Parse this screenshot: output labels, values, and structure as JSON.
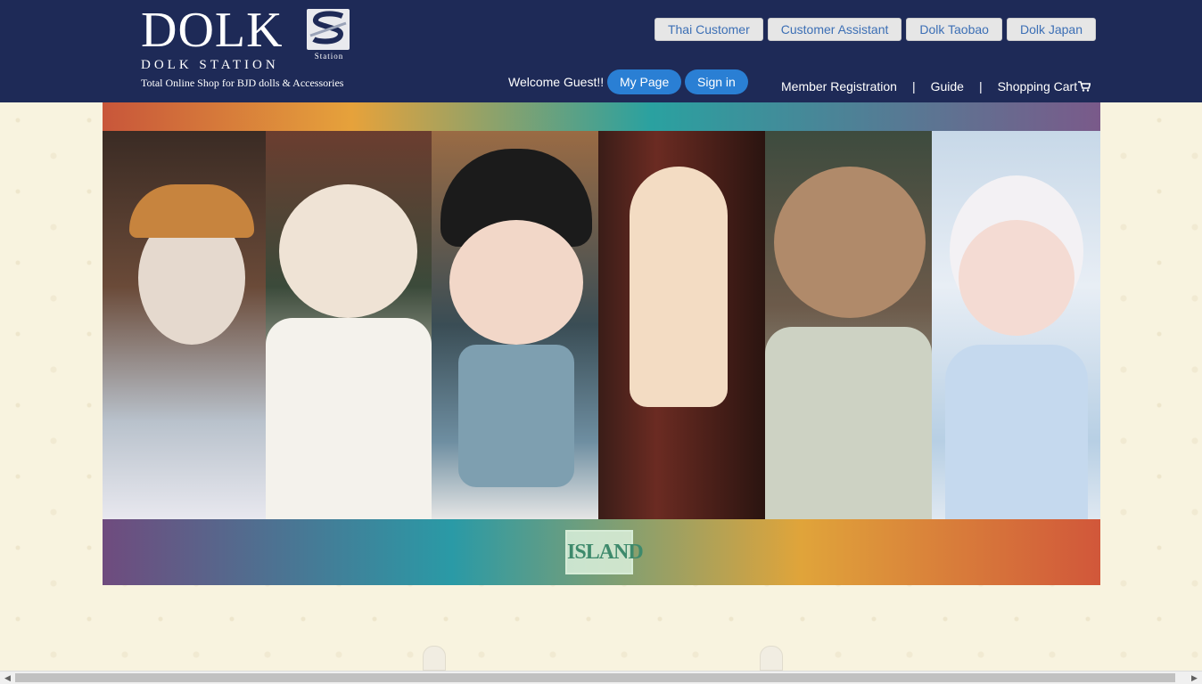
{
  "header": {
    "logo": {
      "wordmark": "DOLK",
      "mark_caption": "Station",
      "subtitle": "DOLK STATION",
      "tagline": "Total Online Shop for BJD dolls & Accessories"
    },
    "external_links": [
      "Thai Customer",
      "Customer Assistant",
      "Dolk Taobao",
      "Dolk Japan"
    ],
    "welcome_text": "Welcome Guest!!",
    "my_page_label": "My Page",
    "sign_in_label": "Sign in",
    "nav": {
      "member_registration": "Member Registration",
      "separator": "|",
      "guide": "Guide",
      "shopping_cart": "Shopping Cart",
      "cart_icon": "cart-icon"
    }
  },
  "banner": {
    "logo_text": "ISLAND"
  },
  "colors": {
    "header_bg": "#1e2a57",
    "pill_blue": "#2a7fd4",
    "link_blue": "#3c6fb5",
    "page_bg": "#f8f3df"
  }
}
